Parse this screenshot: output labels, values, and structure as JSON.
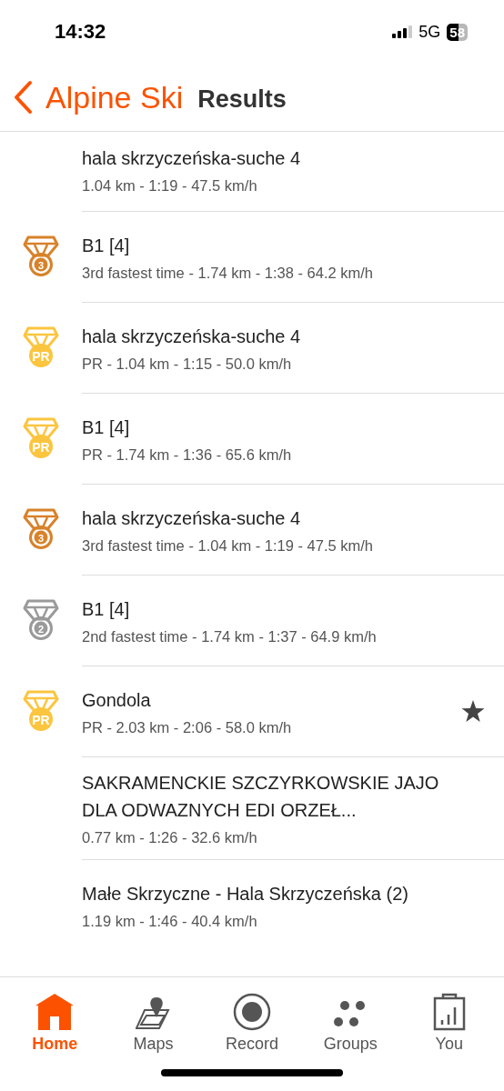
{
  "status_bar": {
    "time": "14:32",
    "network": "5G",
    "battery": "58"
  },
  "header": {
    "back_label": "Alpine Ski",
    "title": "Results"
  },
  "results": [
    {
      "title": "hala skrzyczeńska-suche 4",
      "details": "1.04 km - 1:19 - 47.5 km/h",
      "starred": false
    },
    {
      "medal": {
        "kind": "bronze",
        "label": "3"
      },
      "title": "B1 [4]",
      "details": "3rd fastest time - 1.74 km - 1:38 - 64.2 km/h",
      "starred": false
    },
    {
      "medal": {
        "kind": "pr",
        "label": "PR"
      },
      "title": "hala skrzyczeńska-suche 4",
      "details": "PR - 1.04 km - 1:15 - 50.0 km/h",
      "starred": false
    },
    {
      "medal": {
        "kind": "pr",
        "label": "PR"
      },
      "title": "B1 [4]",
      "details": "PR - 1.74 km - 1:36 - 65.6 km/h",
      "starred": false
    },
    {
      "medal": {
        "kind": "bronze",
        "label": "3"
      },
      "title": "hala skrzyczeńska-suche 4",
      "details": "3rd fastest time - 1.04 km - 1:19 - 47.5 km/h",
      "starred": false
    },
    {
      "medal": {
        "kind": "silver",
        "label": "2"
      },
      "title": "B1 [4]",
      "details": "2nd fastest time - 1.74 km - 1:37 - 64.9 km/h",
      "starred": false
    },
    {
      "medal": {
        "kind": "pr",
        "label": "PR"
      },
      "title": "Gondola",
      "details": "PR - 2.03 km - 2:06 - 58.0 km/h",
      "starred": true
    },
    {
      "title": "SAKRAMENCKIE SZCZYRKOWSKIE JAJO DLA  ODWAZNYCH  EDI ORZEŁ...",
      "details": "0.77 km - 1:26 - 32.6 km/h",
      "starred": false
    },
    {
      "title": "Małe Skrzyczne - Hala Skrzyczeńska (2)",
      "details": "1.19 km - 1:46 - 40.4 km/h",
      "starred": false
    }
  ],
  "tab_bar": [
    {
      "kind": "home",
      "label": "Home",
      "selected": true
    },
    {
      "kind": "maps",
      "label": "Maps",
      "selected": false
    },
    {
      "kind": "record",
      "label": "Record",
      "selected": false
    },
    {
      "kind": "groups",
      "label": "Groups",
      "selected": false
    },
    {
      "kind": "you",
      "label": "You",
      "selected": false
    }
  ]
}
